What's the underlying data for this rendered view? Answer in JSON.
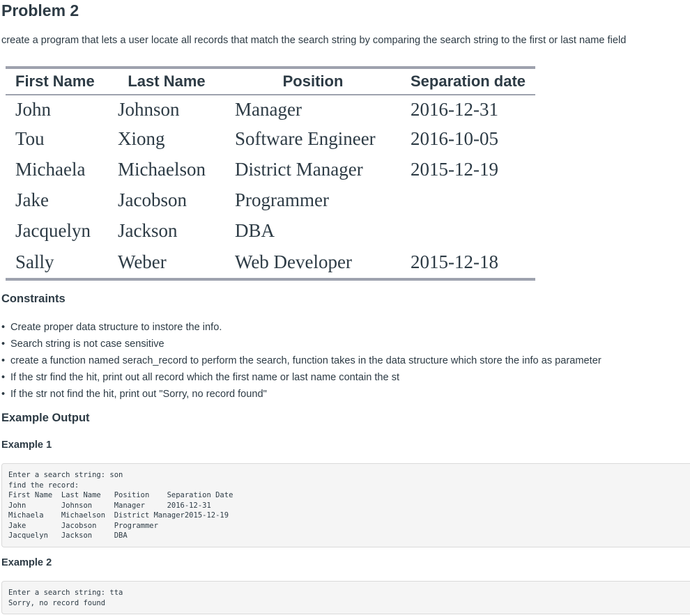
{
  "title": "Problem 2",
  "description": "create a program that lets a user locate all records that match the search string by comparing the search string to the first or last name field",
  "table": {
    "headers": [
      "First Name",
      "Last Name",
      "Position",
      "Separation date"
    ],
    "rows": [
      [
        "John",
        "Johnson",
        "Manager",
        "2016-12-31"
      ],
      [
        "Tou",
        "Xiong",
        "Software Engineer",
        "2016-10-05"
      ],
      [
        "Michaela",
        "Michaelson",
        "District Manager",
        "2015-12-19"
      ],
      [
        "Jake",
        "Jacobson",
        "Programmer",
        ""
      ],
      [
        "Jacquelyn",
        "Jackson",
        "DBA",
        ""
      ],
      [
        "Sally",
        "Weber",
        "Web Developer",
        "2015-12-18"
      ]
    ]
  },
  "constraints": {
    "heading": "Constraints",
    "bullet": "•",
    "items": [
      "Create proper data structure to instore the info.",
      "Search string is not case sensitive",
      "create a function named serach_record to perform the search, function takes in the data structure which store the info as parameter",
      "If the str find the hit, print out all record which the first name or last name contain the st",
      "If the str not find the hit, print out \"Sorry, no record found\""
    ]
  },
  "example_output": {
    "heading": "Example Output",
    "example1": {
      "heading": "Example 1",
      "code": "Enter a search string: son\nfind the record:\nFirst Name  Last Name   Position    Separation Date\nJohn        Johnson     Manager     2016-12-31\nMichaela    Michaelson  District Manager2015-12-19\nJake        Jacobson    Programmer\nJacquelyn   Jackson     DBA"
    },
    "example2": {
      "heading": "Example 2",
      "code": "Enter a search string: tta\nSorry, no record found"
    }
  }
}
